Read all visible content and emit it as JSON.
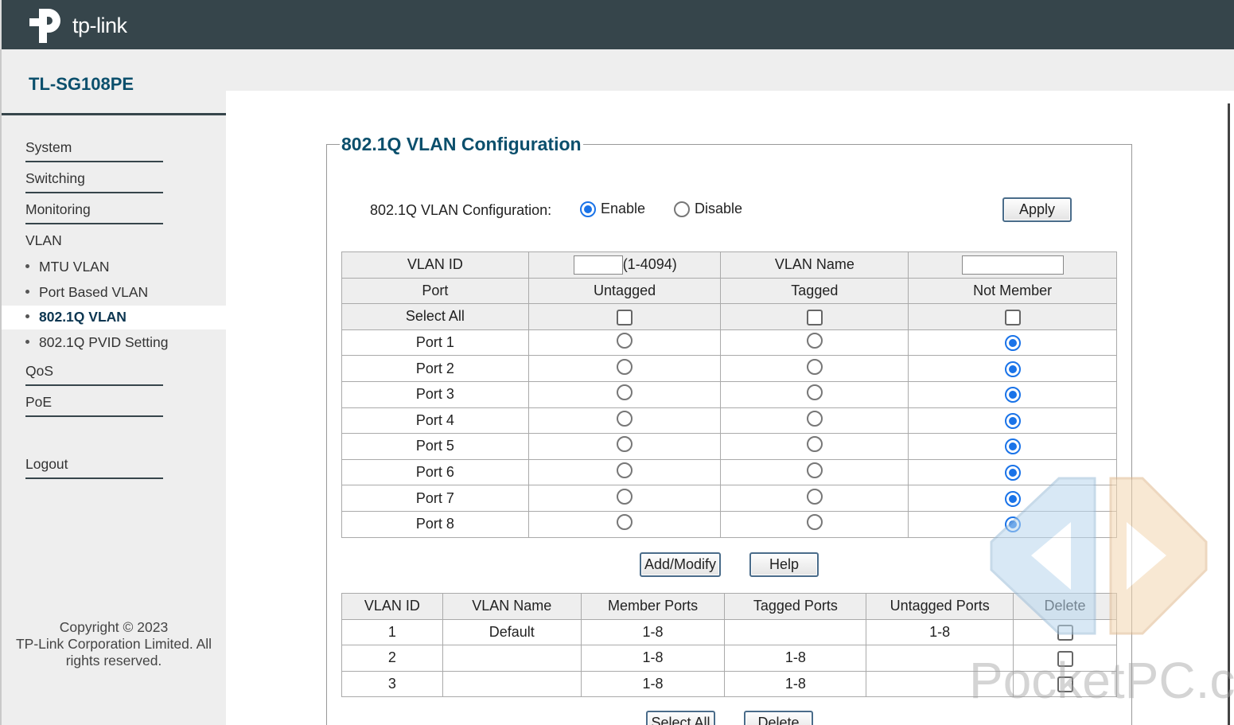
{
  "header": {
    "logo_text": "tp-link"
  },
  "sidebar": {
    "model": "TL-SG108PE",
    "items": [
      {
        "label": "System"
      },
      {
        "label": "Switching"
      },
      {
        "label": "Monitoring"
      },
      {
        "label": "VLAN"
      }
    ],
    "vlan_sub": [
      {
        "label": "MTU VLAN"
      },
      {
        "label": "Port Based VLAN"
      },
      {
        "label": "802.1Q VLAN",
        "active": true
      },
      {
        "label": "802.1Q PVID Setting"
      }
    ],
    "items_after": [
      {
        "label": "QoS"
      },
      {
        "label": "PoE"
      }
    ],
    "logout": "Logout",
    "copyright_l1": "Copyright © 2023",
    "copyright_l2": "TP-Link Corporation Limited. All",
    "copyright_l3": "rights reserved."
  },
  "main": {
    "title": "802.1Q VLAN Configuration",
    "config_label": "802.1Q VLAN Configuration:",
    "enable_label": "Enable",
    "disable_label": "Disable",
    "mode": "Enable",
    "apply": "Apply",
    "form": {
      "vlan_id_label": "VLAN ID",
      "vlan_id_range": "(1-4094)",
      "vlan_id_value": "",
      "vlan_name_label": "VLAN Name",
      "vlan_name_value": "",
      "col_port": "Port",
      "col_untagged": "Untagged",
      "col_tagged": "Tagged",
      "col_not_member": "Not Member",
      "select_all": "Select All",
      "ports": [
        {
          "name": "Port 1",
          "membership": "Not Member"
        },
        {
          "name": "Port 2",
          "membership": "Not Member"
        },
        {
          "name": "Port 3",
          "membership": "Not Member"
        },
        {
          "name": "Port 4",
          "membership": "Not Member"
        },
        {
          "name": "Port 5",
          "membership": "Not Member"
        },
        {
          "name": "Port 6",
          "membership": "Not Member"
        },
        {
          "name": "Port 7",
          "membership": "Not Member"
        },
        {
          "name": "Port 8",
          "membership": "Not Member"
        }
      ]
    },
    "add_modify": "Add/Modify",
    "help": "Help",
    "vlan_table": {
      "headers": [
        "VLAN ID",
        "VLAN Name",
        "Member Ports",
        "Tagged Ports",
        "Untagged Ports",
        "Delete"
      ],
      "rows": [
        {
          "id": "1",
          "name": "Default",
          "members": "1-8",
          "tagged": "",
          "untagged": "1-8"
        },
        {
          "id": "2",
          "name": "",
          "members": "1-8",
          "tagged": "1-8",
          "untagged": ""
        },
        {
          "id": "3",
          "name": "",
          "members": "1-8",
          "tagged": "1-8",
          "untagged": ""
        }
      ]
    },
    "select_all_btn": "Select All",
    "delete_btn": "Delete"
  },
  "watermark": "PocketPC.ch"
}
